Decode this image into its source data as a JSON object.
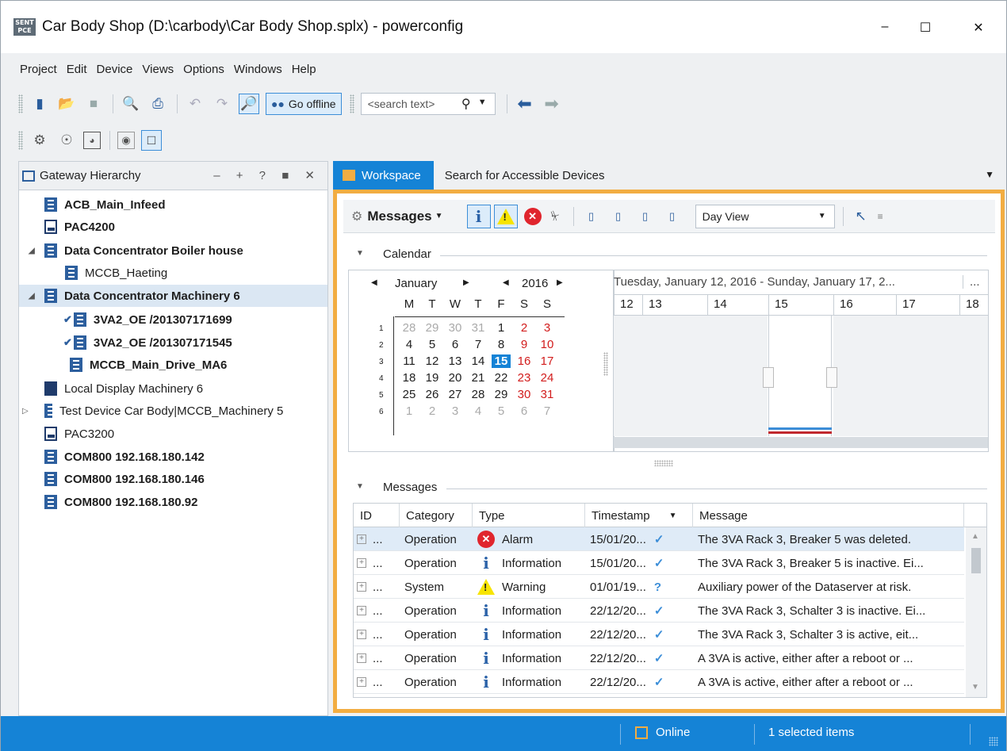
{
  "window": {
    "title": "Car Body Shop (D:\\carbody\\Car Body Shop.splx) - powerconfig",
    "icon_text": "SENT PCE",
    "minimize": "–",
    "maximize": "☐",
    "close": "✕"
  },
  "menu": [
    "Project",
    "Edit",
    "Device",
    "Views",
    "Options",
    "Windows",
    "Help"
  ],
  "toolbar": {
    "go_offline": "Go offline",
    "search_placeholder": "<search text>"
  },
  "left_panel": {
    "title": "Gateway Hierarchy",
    "controls": "– + ? ■ ✕",
    "items": [
      "ACB_Main_Infeed",
      "PAC4200",
      "Data Concentrator Boiler house",
      "MCCB_Haeting",
      "Data Concentrator Machinery 6",
      "3VA2_OE /201307171699",
      "3VA2_OE /201307171545",
      "MCCB_Main_Drive_MA6",
      "Local Display Machinery 6",
      "Test Device Car Body|MCCB_Machinery 5",
      "PAC3200",
      "COM800 192.168.180.142",
      "COM800 192.168.180.146",
      "COM800 192.168.180.92"
    ]
  },
  "tabs": {
    "workspace": "Workspace",
    "search": "Search for Accessible Devices"
  },
  "messages_toolbar": {
    "title": "Messages",
    "view_select": "Day View"
  },
  "calendar": {
    "section": "Calendar",
    "month": "January",
    "year": "2016",
    "weekdays": [
      "M",
      "T",
      "W",
      "T",
      "F",
      "S",
      "S"
    ],
    "weeks": [
      [
        "1",
        "28",
        "29",
        "30",
        "31",
        "1",
        "2",
        "3"
      ],
      [
        "2",
        "4",
        "5",
        "6",
        "7",
        "8",
        "9",
        "10"
      ],
      [
        "3",
        "11",
        "12",
        "13",
        "14",
        "15",
        "16",
        "17"
      ],
      [
        "4",
        "18",
        "19",
        "20",
        "21",
        "22",
        "23",
        "24"
      ],
      [
        "5",
        "25",
        "26",
        "27",
        "28",
        "29",
        "30",
        "31"
      ],
      [
        "6",
        "1",
        "2",
        "3",
        "4",
        "5",
        "6",
        "7"
      ]
    ],
    "selected_day": "15",
    "range_title": "Tuesday, January 12, 2016 - Sunday, January 17, 2...",
    "range_more": "...",
    "day_headers": [
      "12",
      "13",
      "14",
      "15",
      "16",
      "17",
      "18"
    ]
  },
  "messages": {
    "section": "Messages",
    "columns": [
      "ID",
      "Category",
      "Type",
      "Timestamp",
      "Message"
    ],
    "rows": [
      {
        "id": "...",
        "category": "Operation",
        "type": "Alarm",
        "icon": "alarm-icon",
        "timestamp": "15/01/20...",
        "status": "✓",
        "message": "The 3VA Rack 3, Breaker 5 was deleted."
      },
      {
        "id": "...",
        "category": "Operation",
        "type": "Information",
        "icon": "info-icon",
        "timestamp": "15/01/20...",
        "status": "✓",
        "message": "The 3VA Rack 3, Breaker 5 is inactive. Ei..."
      },
      {
        "id": "...",
        "category": "System",
        "type": "Warning",
        "icon": "warning-icon",
        "timestamp": "01/01/19...",
        "status": "?",
        "message": "Auxiliary power of the Dataserver at risk."
      },
      {
        "id": "...",
        "category": "Operation",
        "type": "Information",
        "icon": "info-icon",
        "timestamp": "22/12/20...",
        "status": "✓",
        "message": "The 3VA Rack 3, Schalter 3 is inactive. Ei..."
      },
      {
        "id": "...",
        "category": "Operation",
        "type": "Information",
        "icon": "info-icon",
        "timestamp": "22/12/20...",
        "status": "✓",
        "message": "The 3VA Rack 3, Schalter 3 is active, eit..."
      },
      {
        "id": "...",
        "category": "Operation",
        "type": "Information",
        "icon": "info-icon",
        "timestamp": "22/12/20...",
        "status": "✓",
        "message": "A 3VA is active, either after a reboot or ..."
      },
      {
        "id": "...",
        "category": "Operation",
        "type": "Information",
        "icon": "info-icon",
        "timestamp": "22/12/20...",
        "status": "✓",
        "message": "A 3VA is active, either after a reboot or ..."
      }
    ]
  },
  "status": {
    "online": "Online",
    "selected": "1 selected items"
  },
  "colors": {
    "accent": "#1583d6",
    "workspace_border": "#f2ad42",
    "alarm": "#e0252d",
    "warning": "#f7e400",
    "info": "#2b62a8"
  }
}
